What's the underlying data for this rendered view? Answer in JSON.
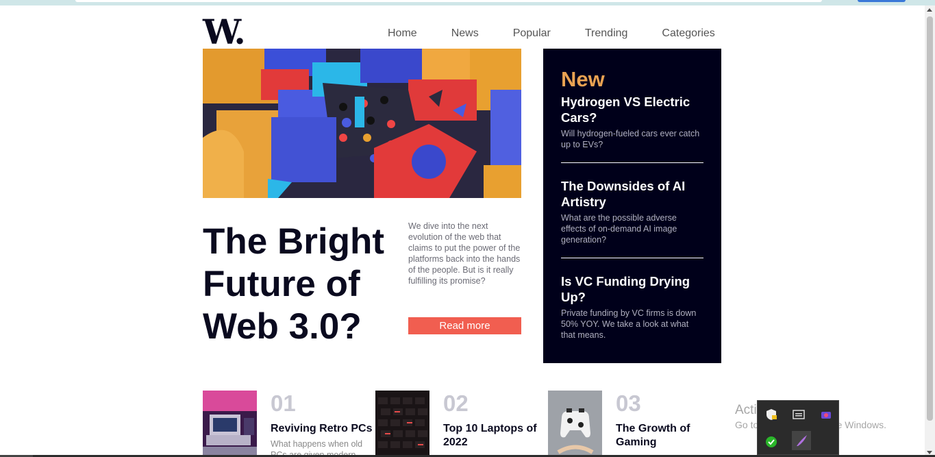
{
  "logo": {
    "text": "W."
  },
  "nav": {
    "items": [
      "Home",
      "News",
      "Popular",
      "Trending",
      "Categories"
    ]
  },
  "hero": {
    "headline": "The Bright Future of Web 3.0?",
    "description": "We dive into the next evolution of the web that claims to put the power of the platforms back into the hands of the people. But is it really fulfilling its promise?",
    "read_more_label": "Read more",
    "image_icon": "abstract-3d-blocks-image"
  },
  "new_panel": {
    "title": "New",
    "items": [
      {
        "title": "Hydrogen VS Electric Cars?",
        "desc": "Will hydrogen-fueled cars ever catch up to EVs?"
      },
      {
        "title": "The Downsides of AI Artistry",
        "desc": "What are the possible adverse effects of on-demand AI image generation?"
      },
      {
        "title": "Is VC Funding Drying Up?",
        "desc": "Private funding by VC firms is down 50% YOY. We take a look at what that means."
      }
    ]
  },
  "bottom_articles": [
    {
      "num": "01",
      "title": "Reviving Retro PCs",
      "desc": "What happens when old PCs are given modern"
    },
    {
      "num": "02",
      "title": "Top 10 Laptops of 2022",
      "desc": ""
    },
    {
      "num": "03",
      "title": "The Growth of Gaming",
      "desc": ""
    }
  ],
  "watermark": {
    "line1": "Activate Windows",
    "line2": "Go to Settings to activate Windows."
  },
  "colors": {
    "accent_red": "#f15e50",
    "accent_orange": "#e9a252",
    "panel_bg": "#00001a"
  }
}
